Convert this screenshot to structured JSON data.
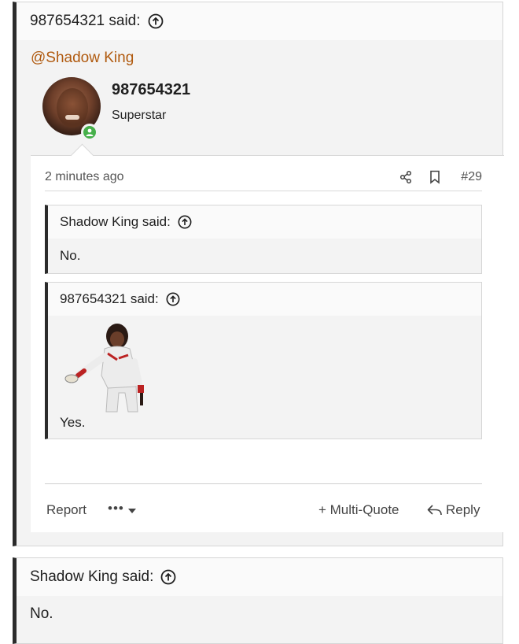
{
  "outer_quote": {
    "author_said": "987654321 said:"
  },
  "mention": "@Shadow King",
  "user": {
    "name": "987654321",
    "title": "Superstar"
  },
  "post": {
    "time": "2 minutes ago",
    "number": "#29",
    "quote1": {
      "author_said": "Shadow King said:",
      "body": "No."
    },
    "quote2": {
      "author_said": "987654321 said:",
      "body": "Yes."
    }
  },
  "actions": {
    "report": "Report",
    "more": "•••",
    "multi_quote": "+ Multi-Quote",
    "reply": "Reply"
  },
  "lower_quote": {
    "author_said": "Shadow King said:",
    "body": "No."
  },
  "colors": {
    "mention": "#b05a0f",
    "online": "#46b04a",
    "quote_bar": "#2b2b2b"
  }
}
